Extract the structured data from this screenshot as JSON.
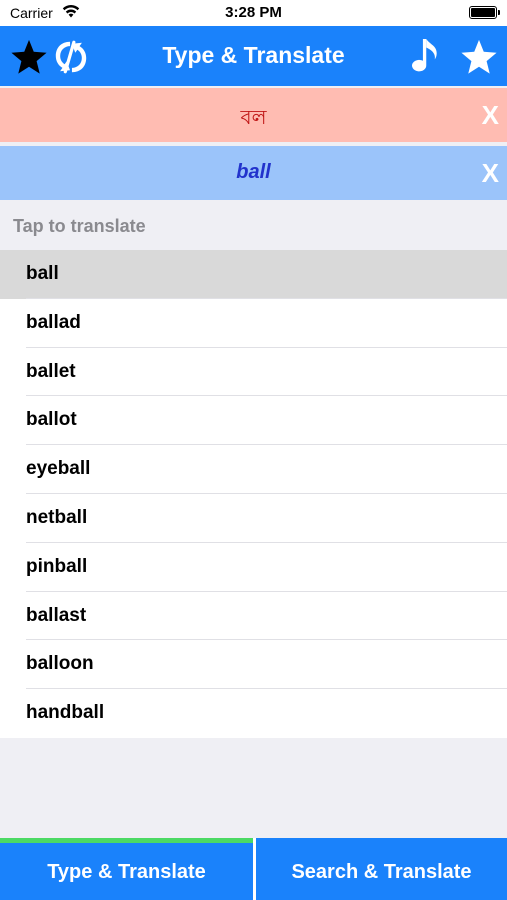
{
  "status_bar": {
    "carrier": "Carrier",
    "time": "3:28 PM"
  },
  "nav": {
    "title": "Type & Translate",
    "color": "#1a82fb"
  },
  "source": {
    "text": "বল",
    "clear_label": "X",
    "color": "#ffbcb2"
  },
  "target": {
    "text": "ball",
    "clear_label": "X",
    "color": "#9bc4fa"
  },
  "section": {
    "header": "Tap to translate"
  },
  "suggestions": [
    "ball",
    "ballad",
    "ballet",
    "ballot",
    "eyeball",
    "netball",
    "pinball",
    "ballast",
    "balloon",
    "handball"
  ],
  "selected_index": 0,
  "tabs": [
    {
      "label": "Type & Translate",
      "active": true
    },
    {
      "label": "Search & Translate",
      "active": false
    }
  ],
  "icons": {
    "left": [
      "star-icon",
      "sync-icon"
    ],
    "right": [
      "music-note-icon",
      "star-icon"
    ]
  }
}
